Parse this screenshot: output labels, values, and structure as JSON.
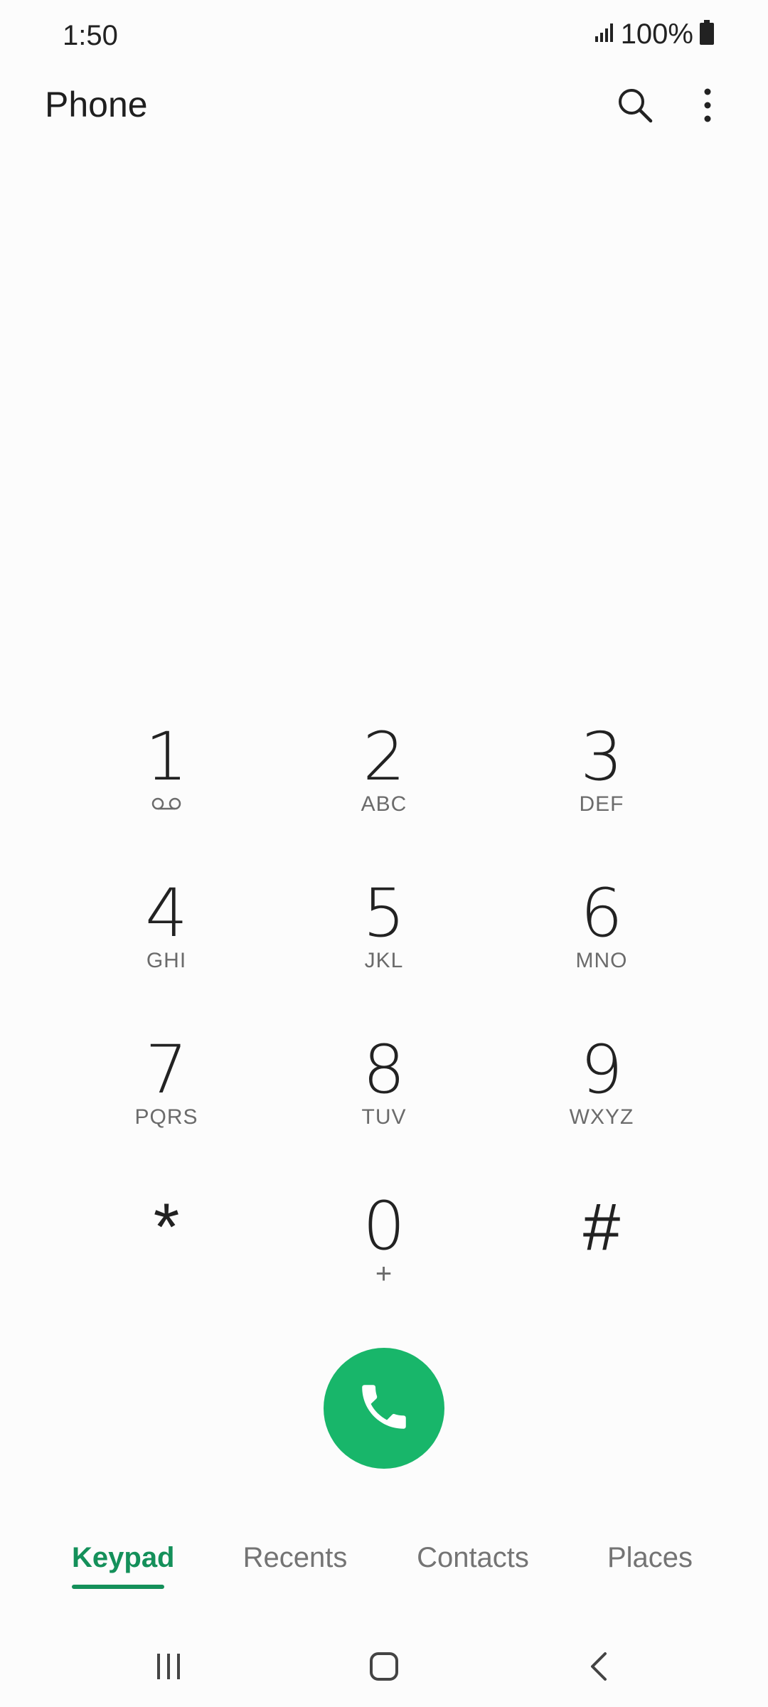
{
  "status_bar": {
    "time": "1:50",
    "battery_percent": "100%",
    "signal_icon": "signal-icon",
    "battery_icon": "battery-icon"
  },
  "app_bar": {
    "title": "Phone",
    "search_icon": "search-icon",
    "more_icon": "more-vert-icon"
  },
  "keypad": {
    "keys": [
      {
        "digit": "1",
        "letters": "",
        "sub_icon": "voicemail-icon"
      },
      {
        "digit": "2",
        "letters": "ABC"
      },
      {
        "digit": "3",
        "letters": "DEF"
      },
      {
        "digit": "4",
        "letters": "GHI"
      },
      {
        "digit": "5",
        "letters": "JKL"
      },
      {
        "digit": "6",
        "letters": "MNO"
      },
      {
        "digit": "7",
        "letters": "PQRS"
      },
      {
        "digit": "8",
        "letters": "TUV"
      },
      {
        "digit": "9",
        "letters": "WXYZ"
      },
      {
        "digit": "*",
        "letters": ""
      },
      {
        "digit": "0",
        "letters": "+"
      },
      {
        "digit": "#",
        "letters": ""
      }
    ]
  },
  "call_button": {
    "icon": "phone-icon",
    "color": "#18b66a"
  },
  "tabs": [
    {
      "label": "Keypad",
      "active": true
    },
    {
      "label": "Recents",
      "active": false
    },
    {
      "label": "Contacts",
      "active": false
    },
    {
      "label": "Places",
      "active": false
    }
  ],
  "accent_color": "#14905a",
  "nav_bar": {
    "recents_icon": "recent-apps-icon",
    "home_icon": "home-icon",
    "back_icon": "back-icon"
  }
}
